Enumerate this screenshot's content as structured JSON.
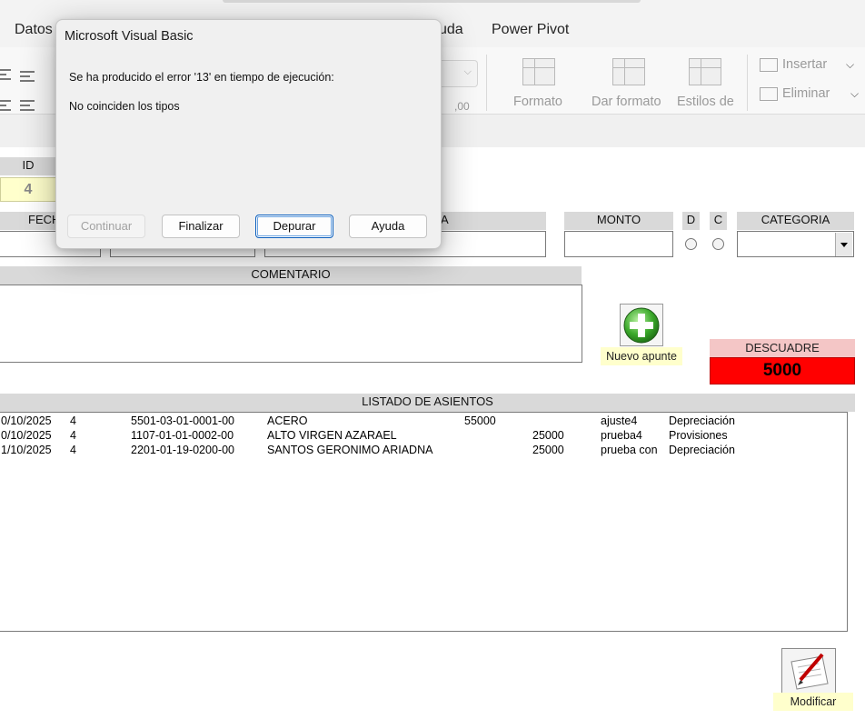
{
  "ribbon": {
    "tabs": [
      "Datos",
      "uda",
      "Power Pivot"
    ],
    "group_labels": [
      "Formato",
      "Dar formato",
      "Estilos de"
    ],
    "cells_commands": [
      "Insertar",
      "Eliminar"
    ],
    "number_decimals": ",00"
  },
  "form": {
    "id_label": "ID",
    "id_value": "4",
    "fecha_label": "FECH",
    "cuenta_label_tail": "A",
    "monto_label": "MONTO",
    "debe_label": "D",
    "credito_label": "C",
    "categoria_label": "CATEGORIA",
    "comentario_label": "COMENTARIO",
    "nuevo_apunte_label": "Nuevo apunte",
    "descuadre_label": "DESCUADRE",
    "descuadre_value": "5000",
    "listado_label": "LISTADO DE ASIENTOS",
    "modificar_label": "Modificar",
    "rows": [
      {
        "fecha": "0/10/2025",
        "id": "4",
        "cuenta": "5501-03-01-0001-00",
        "nombre": "ACERO",
        "debe": "55000",
        "haber": "",
        "comentario": "ajuste4",
        "categoria": "Depreciación"
      },
      {
        "fecha": "0/10/2025",
        "id": "4",
        "cuenta": "1107-01-01-0002-00",
        "nombre": "ALTO VIRGEN AZARAEL",
        "debe": "",
        "haber": "25000",
        "comentario": "prueba4",
        "categoria": "Provisiones"
      },
      {
        "fecha": "1/10/2025",
        "id": "4",
        "cuenta": "2201-01-19-0200-00",
        "nombre": "SANTOS GERONIMO ARIADNA",
        "debe": "",
        "haber": "25000",
        "comentario": "prueba con",
        "categoria": "Depreciación"
      }
    ]
  },
  "dialog": {
    "title": "Microsoft Visual Basic",
    "message_line1": "Se ha producido el error '13' en tiempo de ejecución:",
    "message_line2": "No coinciden los tipos",
    "buttons": {
      "continuar": "Continuar",
      "finalizar": "Finalizar",
      "depurar": "Depurar",
      "ayuda": "Ayuda"
    }
  },
  "colors": {
    "header_gray": "#d9d9d9",
    "id_field_bg": "#ffffcc",
    "descuadre_header": "#f4c6c6",
    "descuadre_value_bg": "#ff0000",
    "tooltip_bg": "#ffffcc",
    "default_button_border": "#0a5ebd"
  }
}
